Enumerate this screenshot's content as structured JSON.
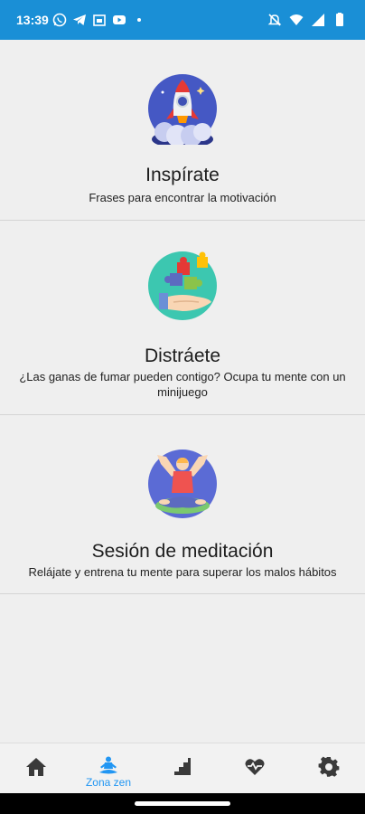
{
  "status_bar": {
    "time": "13:39",
    "notification_icons": [
      "whatsapp-icon",
      "telegram-icon",
      "calendar-icon",
      "youtube-icon",
      "dot-icon"
    ],
    "system_icons": [
      "mute-icon",
      "wifi-icon",
      "signal-icon",
      "battery-icon"
    ],
    "background": "#1a8fd6"
  },
  "cards": [
    {
      "title": "Inspírate",
      "description": "Frases para encontrar la motivación",
      "icon": "rocket-icon"
    },
    {
      "title": "Distráete",
      "description": "¿Las ganas de fumar pueden contigo? Ocupa tu mente con un minijuego",
      "icon": "puzzle-hand-icon"
    },
    {
      "title": "Sesión de meditación",
      "description": "Relájate y entrena tu mente para superar los malos hábitos",
      "icon": "meditation-icon"
    }
  ],
  "bottom_nav": {
    "items": [
      {
        "icon": "home-icon",
        "label": ""
      },
      {
        "icon": "meditation-icon",
        "label": "Zona zen",
        "active": true
      },
      {
        "icon": "stairs-icon",
        "label": ""
      },
      {
        "icon": "heart-pulse-icon",
        "label": ""
      },
      {
        "icon": "gear-icon",
        "label": ""
      }
    ],
    "active_color": "#2196f3",
    "inactive_color": "#3a3a3a"
  }
}
